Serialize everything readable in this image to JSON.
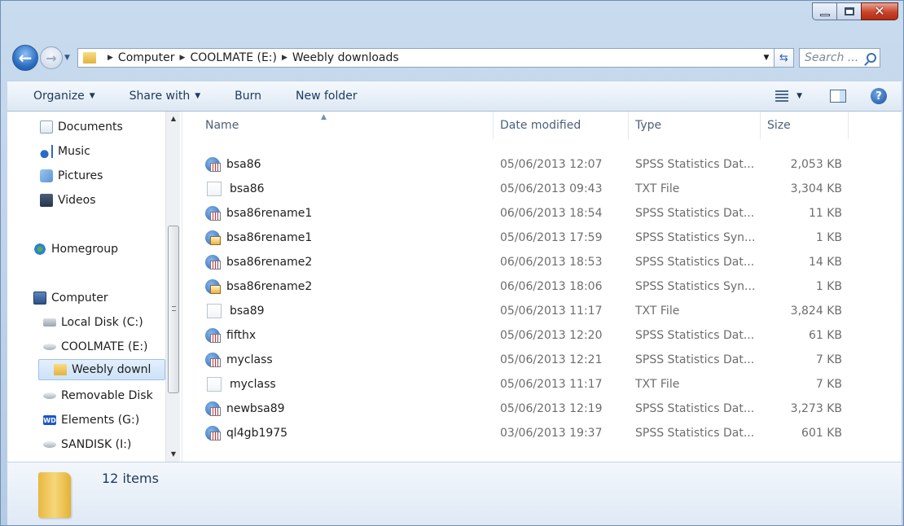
{
  "window": {
    "close_glyph": "✕"
  },
  "nav": {
    "back_glyph": "←",
    "forward_glyph": "→",
    "breadcrumbs": [
      "Computer",
      "COOLMATE (E:)",
      "Weebly downloads"
    ],
    "search_placeholder": "Search ..."
  },
  "toolbar": {
    "organize": "Organize",
    "share_with": "Share with",
    "burn": "Burn",
    "new_folder": "New folder",
    "help_glyph": "?"
  },
  "sidebar": {
    "items": [
      {
        "label": "Documents",
        "icon": "documents-icon"
      },
      {
        "label": "Music",
        "icon": "music-icon"
      },
      {
        "label": "Pictures",
        "icon": "pictures-icon"
      },
      {
        "label": "Videos",
        "icon": "videos-icon"
      },
      {
        "label": "Homegroup",
        "icon": "homegroup-icon"
      },
      {
        "label": "Computer",
        "icon": "computer-icon"
      },
      {
        "label": "Local Disk (C:)",
        "icon": "local-disk-icon"
      },
      {
        "label": "COOLMATE (E:)",
        "icon": "drive-icon"
      },
      {
        "label": "Weebly downl",
        "icon": "folder-icon",
        "selected": true
      },
      {
        "label": "Removable Disk",
        "icon": "drive-icon"
      },
      {
        "label": "Elements (G:)",
        "icon": "wd-drive-icon"
      },
      {
        "label": "SANDISK (I:)",
        "icon": "drive-icon"
      }
    ],
    "wd_badge": "WD"
  },
  "columns": {
    "name": "Name",
    "date": "Date modified",
    "type": "Type",
    "size": "Size"
  },
  "files": [
    {
      "name": "bsa86",
      "date": "05/06/2013 12:07",
      "type": "SPSS Statistics Dat...",
      "size": "2,053 KB",
      "icon": "sav"
    },
    {
      "name": "bsa86",
      "date": "05/06/2013 09:43",
      "type": "TXT File",
      "size": "3,304 KB",
      "icon": "txt"
    },
    {
      "name": "bsa86rename1",
      "date": "06/06/2013 18:54",
      "type": "SPSS Statistics Dat...",
      "size": "11 KB",
      "icon": "sav"
    },
    {
      "name": "bsa86rename1",
      "date": "05/06/2013 17:59",
      "type": "SPSS Statistics Syn...",
      "size": "1 KB",
      "icon": "sps"
    },
    {
      "name": "bsa86rename2",
      "date": "06/06/2013 18:53",
      "type": "SPSS Statistics Dat...",
      "size": "14 KB",
      "icon": "sav"
    },
    {
      "name": "bsa86rename2",
      "date": "06/06/2013 18:06",
      "type": "SPSS Statistics Syn...",
      "size": "1 KB",
      "icon": "sps"
    },
    {
      "name": "bsa89",
      "date": "05/06/2013 11:17",
      "type": "TXT File",
      "size": "3,824 KB",
      "icon": "txt"
    },
    {
      "name": "fifthx",
      "date": "05/06/2013 12:20",
      "type": "SPSS Statistics Dat...",
      "size": "61 KB",
      "icon": "sav"
    },
    {
      "name": "myclass",
      "date": "05/06/2013 12:21",
      "type": "SPSS Statistics Dat...",
      "size": "7 KB",
      "icon": "sav"
    },
    {
      "name": "myclass",
      "date": "05/06/2013 11:17",
      "type": "TXT File",
      "size": "7 KB",
      "icon": "txt"
    },
    {
      "name": "newbsa89",
      "date": "05/06/2013 12:19",
      "type": "SPSS Statistics Dat...",
      "size": "3,273 KB",
      "icon": "sav"
    },
    {
      "name": "ql4gb1975",
      "date": "03/06/2013 19:37",
      "type": "SPSS Statistics Dat...",
      "size": "601 KB",
      "icon": "sav"
    }
  ],
  "details": {
    "item_count": "12 items"
  }
}
